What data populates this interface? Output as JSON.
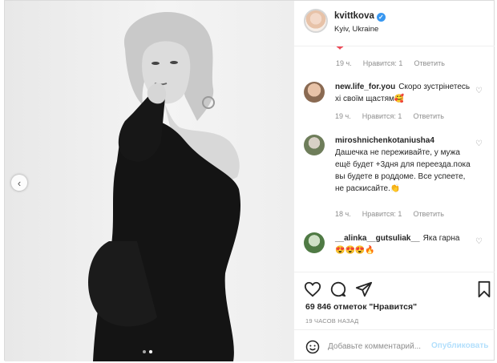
{
  "post": {
    "username": "kvittkova",
    "location": "Kyiv, Ukraine",
    "verified_icon": "verified-check-icon"
  },
  "comments": {
    "top_emoji": "❤",
    "first_meta": {
      "time": "19 ч.",
      "likes": "Нравится: 1",
      "reply": "Ответить"
    },
    "items": [
      {
        "user": "new.life_for.you",
        "text": "Скоро зустрінетесь хі своїм щастям",
        "emoji": "🥰",
        "time": "19 ч.",
        "likes": "Нравится: 1",
        "reply": "Ответить"
      },
      {
        "user": "miroshnichenkotaniusha4",
        "text": "Дашечка не переживайте, у мужа ещё будет +3дня для переезда.пока вы будете в роддоме. Все успеете, не раскисайте.",
        "emoji": "👏",
        "time": "18 ч.",
        "likes": "Нравится: 1",
        "reply": "Ответить"
      },
      {
        "user": "__alinka__gutsuliak__",
        "text": "Яка гарна",
        "emoji": "😍😍😍🔥"
      }
    ]
  },
  "actions": {
    "likes_count": "69 846 отметок \"Нравится\"",
    "date": "19 ЧАСОВ НАЗАД",
    "comment_placeholder": "Добавьте комментарий...",
    "publish_label": "Опубликовать"
  },
  "carousel": {
    "current": 2,
    "total": 2
  },
  "colors": {
    "accent": "#3897f0",
    "heart": "#ed4956",
    "publish_disabled": "#b2dffc",
    "muted": "#8e8e8e"
  },
  "icons": [
    "heart-outline-icon",
    "comment-icon",
    "share-icon",
    "bookmark-icon",
    "emoji-icon",
    "chevron-left-icon"
  ]
}
